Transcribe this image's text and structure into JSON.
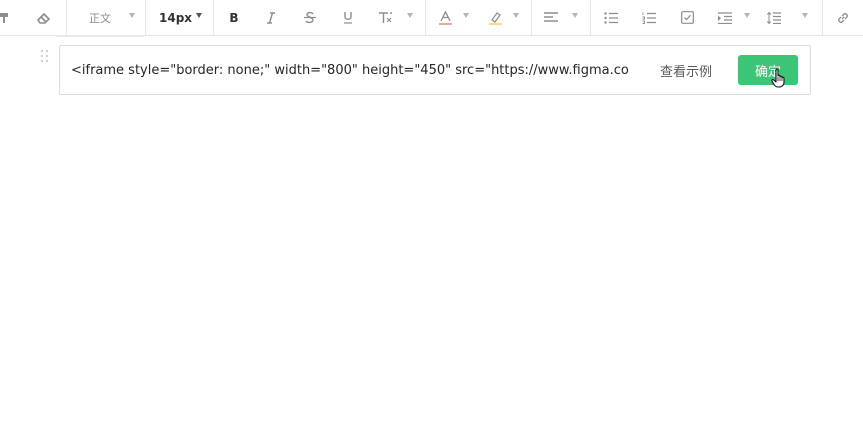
{
  "toolbar": {
    "paragraph_style": "正文",
    "font_size": "14px",
    "bold_label": "B",
    "icons": [
      "format-painter-icon",
      "eraser-icon",
      "bold-icon",
      "italic-icon",
      "strikethrough-icon",
      "underline-icon",
      "clear-format-icon",
      "font-color-icon",
      "highlight-icon",
      "align-icon",
      "bullet-list-icon",
      "numbered-list-icon",
      "checkbox-list-icon",
      "indent-icon",
      "line-height-icon",
      "link-icon"
    ],
    "font_color_accent": "#f0a5a5",
    "highlight_accent": "#f3e27a"
  },
  "embed": {
    "input_value": "<iframe style=\"border: none;\" width=\"800\" height=\"450\" src=\"https://www.figma.co",
    "example_link": "查看示例",
    "confirm_label": "确定",
    "confirm_color": "#3cc576"
  }
}
